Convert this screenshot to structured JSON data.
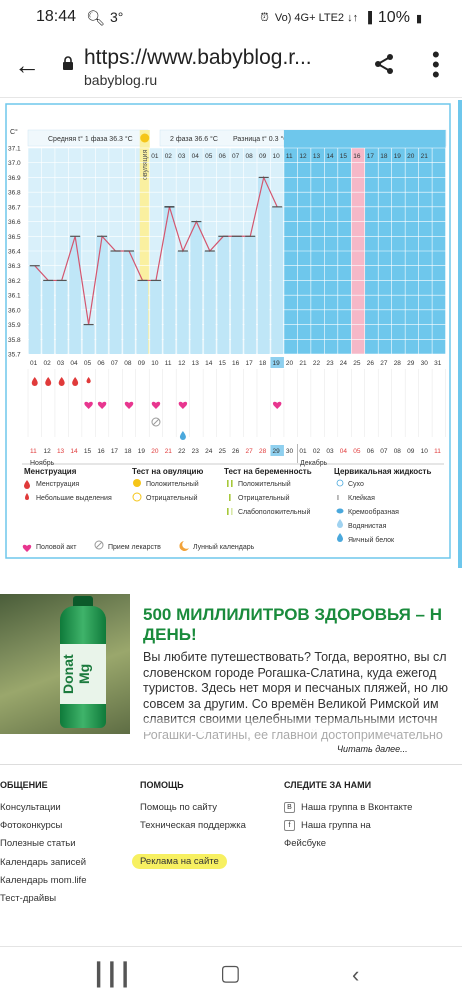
{
  "status": {
    "time": "18:44",
    "temp": "3°",
    "net": "Vo) 4G+ LTE2 ↓↑",
    "battery": "10%"
  },
  "browser": {
    "url": "https://www.babyblog.r...",
    "domain": "babyblog.ru"
  },
  "chart": {
    "unit": "C°",
    "phase1": "Средняя t° 1 фаза 36.3 °C",
    "phase2": "2 фаза 36.6 °C",
    "diff": "Разница t° 0.3 °C",
    "ovulation_label": "овуляция",
    "month_start": "Ноябрь",
    "month_end": "Декабрь"
  },
  "chart_data": {
    "type": "line",
    "title": "",
    "xlabel": "",
    "ylabel": "C°",
    "ylim": [
      35.7,
      37.1
    ],
    "y_ticks": [
      "37.1",
      "37.0",
      "36.9",
      "36.8",
      "36.7",
      "36.6",
      "36.5",
      "36.4",
      "36.3",
      "36.2",
      "36.1",
      "36.0",
      "35.9",
      "35.8",
      "35.7"
    ],
    "cycle_days": [
      "01",
      "02",
      "03",
      "04",
      "05",
      "06",
      "07",
      "08",
      "09",
      "10",
      "11",
      "12",
      "13",
      "14",
      "15",
      "16",
      "17",
      "18",
      "19",
      "20",
      "21",
      "22",
      "23",
      "24",
      "25",
      "26",
      "27",
      "28",
      "29",
      "30",
      "31"
    ],
    "top_days": [
      "01",
      "02",
      "03",
      "04",
      "05",
      "06",
      "07",
      "08",
      "09",
      "10",
      "11",
      "12",
      "13",
      "14",
      "15",
      "16",
      "17",
      "18",
      "19",
      "20",
      "21"
    ],
    "dates": [
      "11",
      "12",
      "13",
      "14",
      "15",
      "16",
      "17",
      "18",
      "19",
      "20",
      "21",
      "22",
      "23",
      "24",
      "25",
      "26",
      "27",
      "28",
      "29",
      "30",
      "01",
      "02",
      "03",
      "04",
      "05",
      "06",
      "07",
      "08",
      "09",
      "10",
      "11"
    ],
    "red_dates": [
      "13",
      "14",
      "20",
      "21",
      "27",
      "28",
      "04",
      "05",
      "11"
    ],
    "current_day": "19",
    "current_date": "29",
    "ovulation_day": "10",
    "pink_day": "25",
    "series": [
      {
        "values": [
          36.3,
          36.2,
          36.2,
          36.5,
          35.9,
          36.5,
          36.4,
          36.4,
          36.2,
          36.2,
          36.7,
          36.4,
          36.6,
          36.4,
          36.5,
          36.5,
          36.5,
          36.9,
          36.7
        ]
      }
    ],
    "menstruation_days": [
      1,
      2,
      3,
      4,
      5
    ],
    "menstruation_small_days": [
      5
    ],
    "intercourse_days": [
      5,
      6,
      8,
      10,
      12,
      19
    ],
    "medicine_days": [
      10
    ],
    "egg_white_days": [
      12
    ]
  },
  "legend": {
    "menstruation_h": "Менструация",
    "menstruation": "Менструация",
    "light_bleeding": "Небольшие выделения",
    "ovulation_test_h": "Тест на овуляцию",
    "ov_positive": "Положительный",
    "ov_negative": "Отрицательный",
    "pregnancy_test_h": "Тест на беременность",
    "pr_positive": "Положительный",
    "pr_negative": "Отрицательный",
    "pr_weak": "Слабоположительный",
    "mucus_h": "Цервикальная жидкость",
    "dry": "Сухо",
    "sticky": "Клейкая",
    "creamy": "Кремообразная",
    "watery": "Водянистая",
    "eggwhite": "Яичный белок",
    "intercourse": "Половой акт",
    "medicine": "Прием лекарств",
    "lunar": "Лунный календарь"
  },
  "ad": {
    "headline1": "500 МИЛЛИЛИТРОВ ЗДОРОВЬЯ – Н",
    "headline2": "ДЕНЬ!",
    "lines": [
      "Вы любите путешествовать? Тогда, вероятно, вы сл",
      "словенском городе Рогашка-Слатина, куда ежегод",
      "туристов. Здесь нет моря и песчаных пляжей, но лю",
      "совсем за другим. Со времён Великой Римской им",
      "славится своими целебными термальными источн",
      "Рогашки-Слатины, её главной достопримечательно"
    ],
    "bottle_text": "Donat Mg",
    "read_more": "Читать далее..."
  },
  "footer": {
    "col1_h": "ОБЩЕНИЕ",
    "col1": [
      "Консультации",
      "Фотоконкурсы",
      "Полезные статьи",
      "Календарь записей",
      "Календарь mom.life",
      "Тест-драйвы"
    ],
    "col2_h": "ПОМОЩЬ",
    "col2": [
      "Помощь по сайту",
      "Техническая поддержка",
      "Реклама на сайте"
    ],
    "col3_h": "СЛЕДИТЕ ЗА НАМИ",
    "vk": "Наша группа в Вконтакте",
    "fb1": "Наша группа на",
    "fb2": "Фейсбуке"
  }
}
